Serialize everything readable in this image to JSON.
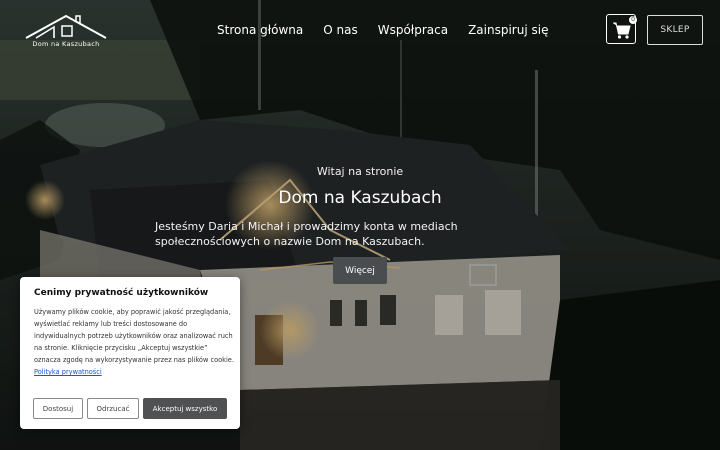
{
  "brand": {
    "name": "Dom na Kaszubach"
  },
  "nav": {
    "items": [
      {
        "label": "Strona główna"
      },
      {
        "label": "O nas"
      },
      {
        "label": "Współpraca"
      },
      {
        "label": "Zainspiruj się"
      }
    ],
    "cart": {
      "icon": "cart-icon",
      "count": "0"
    },
    "shop_label": "SKLEP"
  },
  "hero": {
    "kicker": "Witaj na stronie",
    "title": "Dom na Kaszubach",
    "description": "Jesteśmy Daria i Michał i prowadzimy konta w mediach społecznościowych o nazwie Dom na Kaszubach.",
    "button_label": "Więcej"
  },
  "cookie": {
    "title": "Cenimy prywatność użytkowników",
    "body": "Używamy plików cookie, aby poprawić jakość przeglądania, wyświetlać reklamy lub treści dostosowane do indywidualnych potrzeb użytkowników oraz analizować ruch na stronie. Kliknięcie przycisku „Akceptuj wszystkie” oznacza zgodę na wykorzystywanie przez nas plików cookie.",
    "policy_link": "Polityka prywatności",
    "buttons": {
      "customize": "Dostosuj",
      "reject": "Odrzucać",
      "accept": "Akceptuj wszystko"
    }
  },
  "colors": {
    "primary_button": "#4a4d50",
    "link": "#1d56c6"
  }
}
